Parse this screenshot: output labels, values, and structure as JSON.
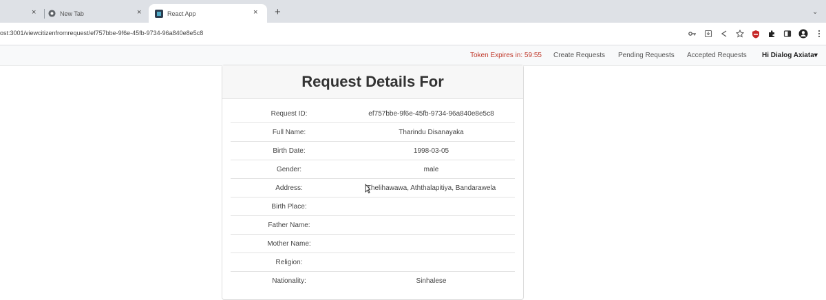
{
  "browser": {
    "tabs": [
      {
        "title": "",
        "active": false
      },
      {
        "title": "New Tab",
        "active": false
      },
      {
        "title": "React App",
        "active": true
      }
    ],
    "close_glyph": "×",
    "new_tab_glyph": "+",
    "tab_list_glyph": "⌄",
    "url": "ost:3001/viewcitizenfromrequest/ef757bbe-9f6e-45fb-9734-96a840e8e5c8"
  },
  "app": {
    "nav": {
      "token_expiry": "Token Expires in: 59:55",
      "create_requests": "Create Requests",
      "pending_requests": "Pending Requests",
      "accepted_requests": "Accepted Requests",
      "user_menu": "Hi Dialog Axiata▾"
    },
    "card": {
      "title": "Request Details For",
      "rows": [
        {
          "label": "Request ID:",
          "value": "ef757bbe-9f6e-45fb-9734-96a840e8e5c8"
        },
        {
          "label": "Full Name:",
          "value": "Tharindu Disanayaka"
        },
        {
          "label": "Birth Date:",
          "value": "1998-03-05"
        },
        {
          "label": "Gender:",
          "value": "male"
        },
        {
          "label": "Address:",
          "value": "Thelihawawa, Aththalapitiya, Bandarawela"
        },
        {
          "label": "Birth Place:",
          "value": ""
        },
        {
          "label": "Father Name:",
          "value": ""
        },
        {
          "label": "Mother Name:",
          "value": ""
        },
        {
          "label": "Religion:",
          "value": ""
        },
        {
          "label": "Nationality:",
          "value": "Sinhalese"
        }
      ]
    }
  },
  "colors": {
    "token_text": "#c0392b",
    "tabbar_bg": "#dee1e6",
    "navbar_bg": "#f8f9fa"
  },
  "icons": [
    "close-icon",
    "chrome-icon",
    "react-app-favicon",
    "plus-icon",
    "chevron-down-icon",
    "key-icon",
    "install-icon",
    "share-icon",
    "star-icon",
    "shield-extension-icon",
    "extensions-icon",
    "side-panel-icon",
    "profile-icon",
    "more-icon",
    "mouse-cursor-icon"
  ]
}
